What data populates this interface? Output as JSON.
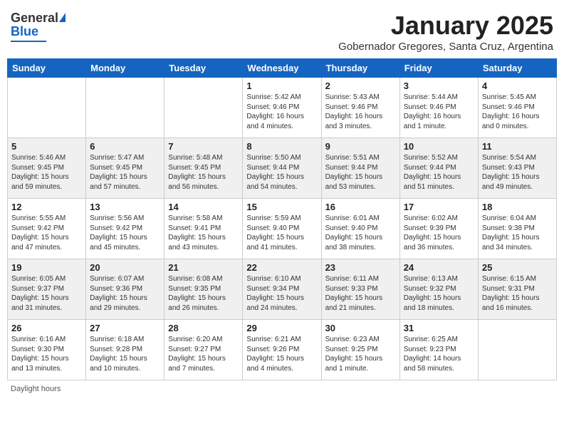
{
  "header": {
    "logo_general": "General",
    "logo_blue": "Blue",
    "month_title": "January 2025",
    "subtitle": "Gobernador Gregores, Santa Cruz, Argentina"
  },
  "weekdays": [
    "Sunday",
    "Monday",
    "Tuesday",
    "Wednesday",
    "Thursday",
    "Friday",
    "Saturday"
  ],
  "footer": {
    "daylight_hours": "Daylight hours"
  },
  "weeks": [
    [
      {
        "day": "",
        "info": ""
      },
      {
        "day": "",
        "info": ""
      },
      {
        "day": "",
        "info": ""
      },
      {
        "day": "1",
        "info": "Sunrise: 5:42 AM\nSunset: 9:46 PM\nDaylight: 16 hours and 4 minutes."
      },
      {
        "day": "2",
        "info": "Sunrise: 5:43 AM\nSunset: 9:46 PM\nDaylight: 16 hours and 3 minutes."
      },
      {
        "day": "3",
        "info": "Sunrise: 5:44 AM\nSunset: 9:46 PM\nDaylight: 16 hours and 1 minute."
      },
      {
        "day": "4",
        "info": "Sunrise: 5:45 AM\nSunset: 9:46 PM\nDaylight: 16 hours and 0 minutes."
      }
    ],
    [
      {
        "day": "5",
        "info": "Sunrise: 5:46 AM\nSunset: 9:45 PM\nDaylight: 15 hours and 59 minutes."
      },
      {
        "day": "6",
        "info": "Sunrise: 5:47 AM\nSunset: 9:45 PM\nDaylight: 15 hours and 57 minutes."
      },
      {
        "day": "7",
        "info": "Sunrise: 5:48 AM\nSunset: 9:45 PM\nDaylight: 15 hours and 56 minutes."
      },
      {
        "day": "8",
        "info": "Sunrise: 5:50 AM\nSunset: 9:44 PM\nDaylight: 15 hours and 54 minutes."
      },
      {
        "day": "9",
        "info": "Sunrise: 5:51 AM\nSunset: 9:44 PM\nDaylight: 15 hours and 53 minutes."
      },
      {
        "day": "10",
        "info": "Sunrise: 5:52 AM\nSunset: 9:44 PM\nDaylight: 15 hours and 51 minutes."
      },
      {
        "day": "11",
        "info": "Sunrise: 5:54 AM\nSunset: 9:43 PM\nDaylight: 15 hours and 49 minutes."
      }
    ],
    [
      {
        "day": "12",
        "info": "Sunrise: 5:55 AM\nSunset: 9:42 PM\nDaylight: 15 hours and 47 minutes."
      },
      {
        "day": "13",
        "info": "Sunrise: 5:56 AM\nSunset: 9:42 PM\nDaylight: 15 hours and 45 minutes."
      },
      {
        "day": "14",
        "info": "Sunrise: 5:58 AM\nSunset: 9:41 PM\nDaylight: 15 hours and 43 minutes."
      },
      {
        "day": "15",
        "info": "Sunrise: 5:59 AM\nSunset: 9:40 PM\nDaylight: 15 hours and 41 minutes."
      },
      {
        "day": "16",
        "info": "Sunrise: 6:01 AM\nSunset: 9:40 PM\nDaylight: 15 hours and 38 minutes."
      },
      {
        "day": "17",
        "info": "Sunrise: 6:02 AM\nSunset: 9:39 PM\nDaylight: 15 hours and 36 minutes."
      },
      {
        "day": "18",
        "info": "Sunrise: 6:04 AM\nSunset: 9:38 PM\nDaylight: 15 hours and 34 minutes."
      }
    ],
    [
      {
        "day": "19",
        "info": "Sunrise: 6:05 AM\nSunset: 9:37 PM\nDaylight: 15 hours and 31 minutes."
      },
      {
        "day": "20",
        "info": "Sunrise: 6:07 AM\nSunset: 9:36 PM\nDaylight: 15 hours and 29 minutes."
      },
      {
        "day": "21",
        "info": "Sunrise: 6:08 AM\nSunset: 9:35 PM\nDaylight: 15 hours and 26 minutes."
      },
      {
        "day": "22",
        "info": "Sunrise: 6:10 AM\nSunset: 9:34 PM\nDaylight: 15 hours and 24 minutes."
      },
      {
        "day": "23",
        "info": "Sunrise: 6:11 AM\nSunset: 9:33 PM\nDaylight: 15 hours and 21 minutes."
      },
      {
        "day": "24",
        "info": "Sunrise: 6:13 AM\nSunset: 9:32 PM\nDaylight: 15 hours and 18 minutes."
      },
      {
        "day": "25",
        "info": "Sunrise: 6:15 AM\nSunset: 9:31 PM\nDaylight: 15 hours and 16 minutes."
      }
    ],
    [
      {
        "day": "26",
        "info": "Sunrise: 6:16 AM\nSunset: 9:30 PM\nDaylight: 15 hours and 13 minutes."
      },
      {
        "day": "27",
        "info": "Sunrise: 6:18 AM\nSunset: 9:28 PM\nDaylight: 15 hours and 10 minutes."
      },
      {
        "day": "28",
        "info": "Sunrise: 6:20 AM\nSunset: 9:27 PM\nDaylight: 15 hours and 7 minutes."
      },
      {
        "day": "29",
        "info": "Sunrise: 6:21 AM\nSunset: 9:26 PM\nDaylight: 15 hours and 4 minutes."
      },
      {
        "day": "30",
        "info": "Sunrise: 6:23 AM\nSunset: 9:25 PM\nDaylight: 15 hours and 1 minute."
      },
      {
        "day": "31",
        "info": "Sunrise: 6:25 AM\nSunset: 9:23 PM\nDaylight: 14 hours and 58 minutes."
      },
      {
        "day": "",
        "info": ""
      }
    ]
  ]
}
